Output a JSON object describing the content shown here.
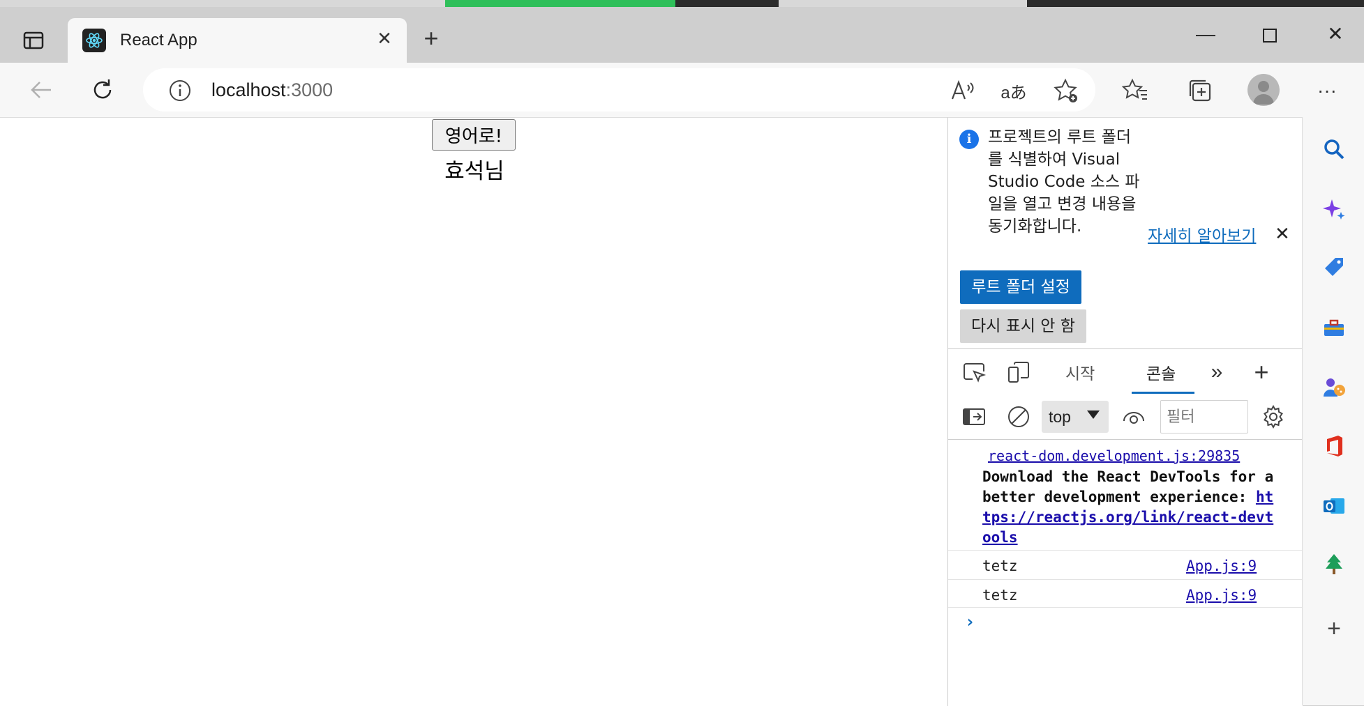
{
  "browser": {
    "tab_title": "React App",
    "url_host": "localhost",
    "url_port": ":3000",
    "favicon": "react-atom-icon"
  },
  "page": {
    "language_button": "영어로!",
    "greeting": "효석님"
  },
  "devtools": {
    "infobar": {
      "text": "프로젝트의 루트 폴더를 식별하여 Visual Studio Code 소스 파일을 열고 변경 내용을 동기화합니다.",
      "learn_more": "자세히 알아보기",
      "set_root_button": "루트 폴더 설정",
      "dont_show_button": "다시 표시 안 함"
    },
    "tabs": [
      {
        "label": "시작"
      },
      {
        "label": "콘솔"
      }
    ],
    "context": "top",
    "filter_placeholder": "필터",
    "console": {
      "source_link": "react-dom.development.js:29835",
      "message_prefix": "Download the React DevTools for a better development experience: ",
      "message_link": "https://reactjs.org/link/react-devtools",
      "logs": [
        {
          "text": "tetz",
          "source": "App.js:9"
        },
        {
          "text": "tetz",
          "source": "App.js:9"
        }
      ],
      "prompt": "›"
    }
  },
  "colors": {
    "accent": "#0f6cbd",
    "link": "#1a0dab"
  }
}
